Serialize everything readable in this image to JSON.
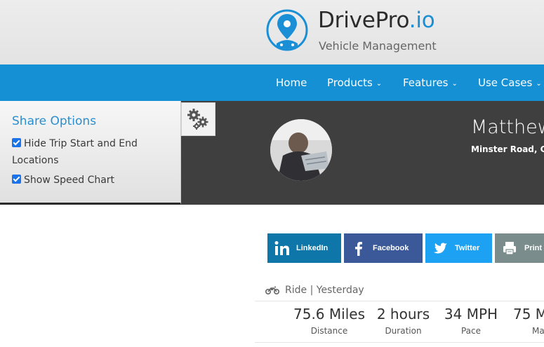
{
  "brand": {
    "name_main": "DrivePro",
    "name_tld": ".io",
    "tagline": "Vehicle Management",
    "accent_color": "#1a8fd6"
  },
  "nav": {
    "items": [
      {
        "label": "Home",
        "has_dropdown": false
      },
      {
        "label": "Products",
        "has_dropdown": true
      },
      {
        "label": "Features",
        "has_dropdown": true
      },
      {
        "label": "Use Cases",
        "has_dropdown": true
      }
    ],
    "dropdown_glyph": "⌄",
    "color": "#1590d4"
  },
  "share_options": {
    "title": "Share Options",
    "options": [
      {
        "label": "Hide Trip Start and End Locations",
        "checked": true
      },
      {
        "label": "Show Speed Chart",
        "checked": true
      }
    ],
    "toggle_icon": "gears-icon"
  },
  "profile": {
    "name": "Matthew",
    "location": "Minster Road, G"
  },
  "share_buttons": [
    {
      "label": "LinkedIn",
      "icon": "linkedin-icon",
      "color": "#0e76a8"
    },
    {
      "label": "Facebook",
      "icon": "facebook-icon",
      "color": "#3b5998"
    },
    {
      "label": "Twitter",
      "icon": "twitter-icon",
      "color": "#1da1f2"
    },
    {
      "label": "Print",
      "icon": "print-icon",
      "color": "#7a8c8c"
    }
  ],
  "ride": {
    "type": "Ride",
    "separator": "|",
    "when": "Yesterday",
    "icon": "motorcycle-icon",
    "stats": [
      {
        "value": "75.6 Miles",
        "label": "Distance"
      },
      {
        "value": "2 hours",
        "label": "Duration"
      },
      {
        "value": "34 MPH",
        "label": "Pace"
      },
      {
        "value": "75 M",
        "label": "Ma"
      }
    ]
  }
}
